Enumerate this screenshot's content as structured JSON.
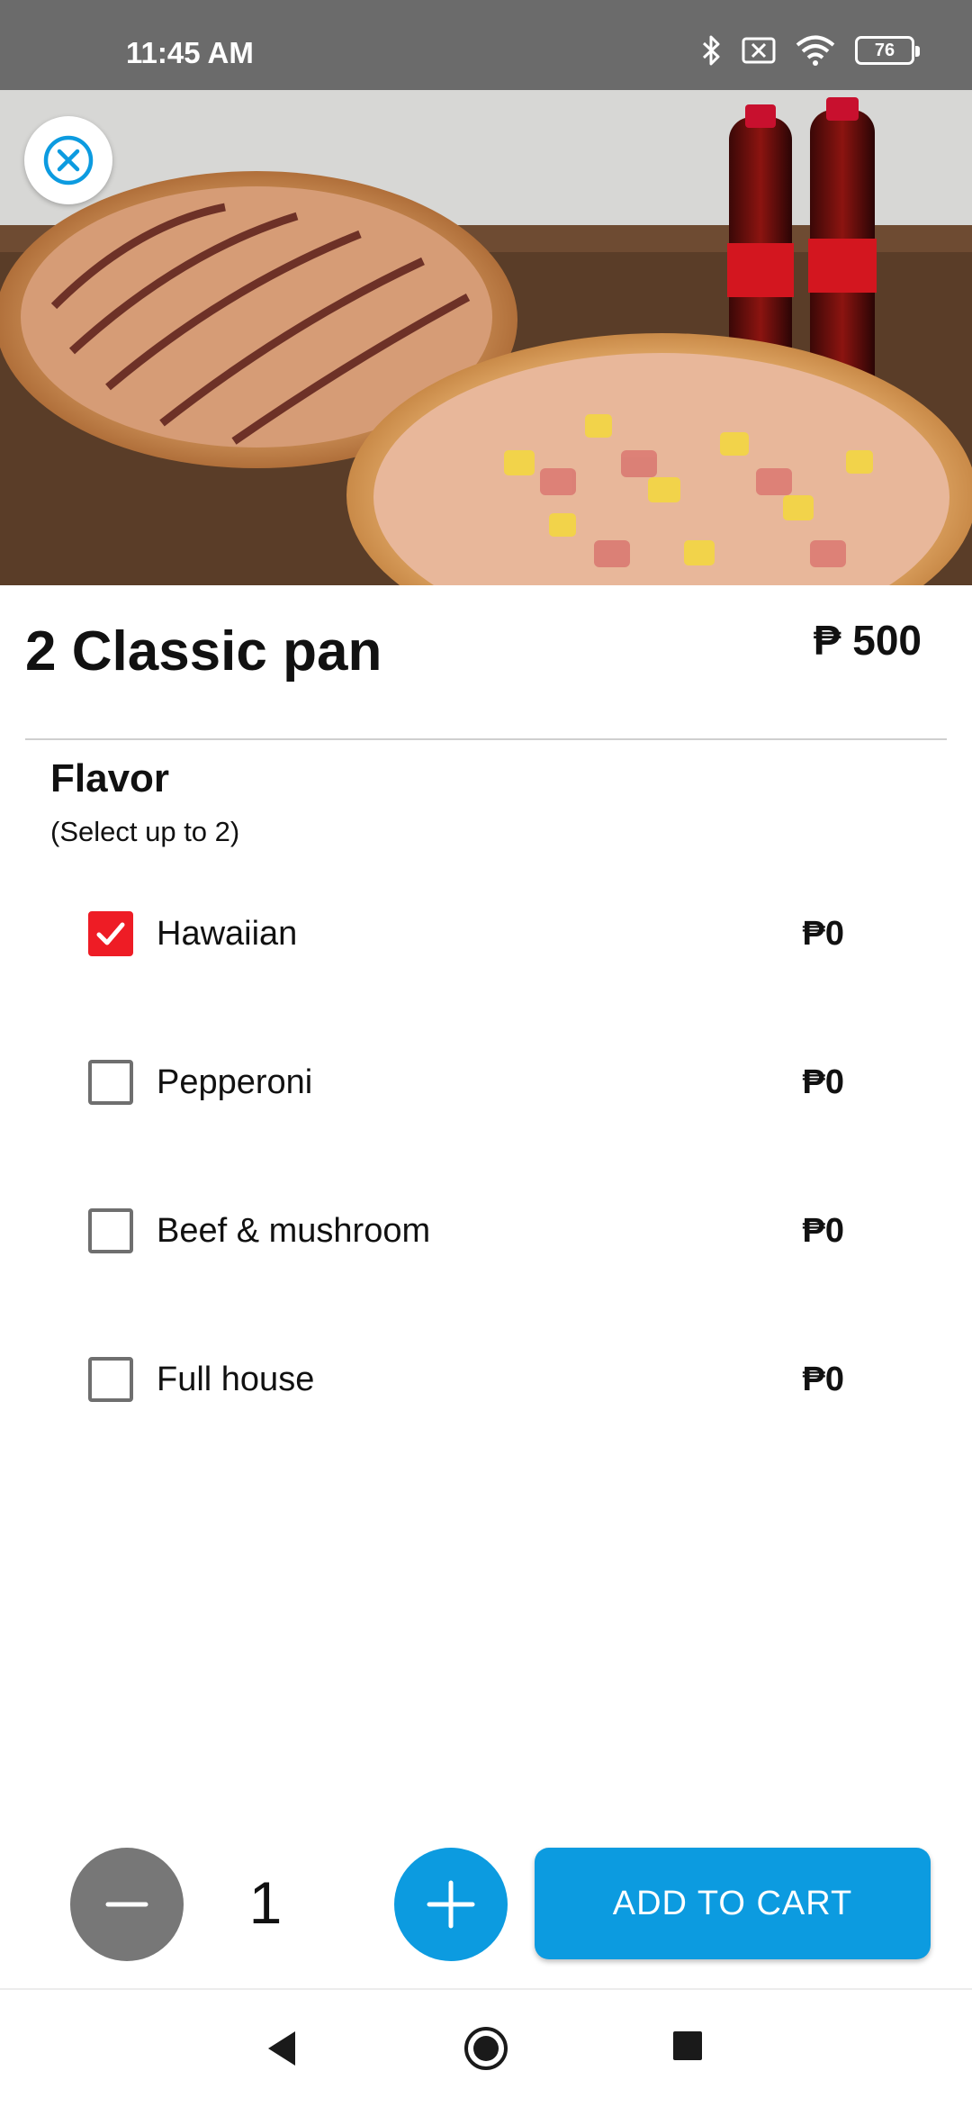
{
  "status_bar": {
    "time": "11:45 AM",
    "battery_level": "76",
    "icons": [
      "bluetooth-icon",
      "notification-mute-icon",
      "wifi-icon",
      "battery-icon"
    ]
  },
  "hero": {
    "image": "pizza-and-soda-photo"
  },
  "product": {
    "title": "2 Classic pan",
    "price": "₱ 500"
  },
  "flavor": {
    "title": "Flavor",
    "subtitle": "(Select up to 2)",
    "options": [
      {
        "label": "Hawaiian",
        "price": "₱0",
        "checked": true
      },
      {
        "label": "Pepperoni",
        "price": "₱0",
        "checked": false
      },
      {
        "label": "Beef & mushroom",
        "price": "₱0",
        "checked": false
      },
      {
        "label": "Full house",
        "price": "₱0",
        "checked": false
      }
    ]
  },
  "quantity": {
    "value": "1"
  },
  "actions": {
    "add_to_cart_label": "ADD TO CART"
  },
  "colors": {
    "accent": "#0c9be0",
    "checkbox_checked": "#ee1c25",
    "minus_button": "#777777",
    "status_bar": "#6b6b6b"
  }
}
